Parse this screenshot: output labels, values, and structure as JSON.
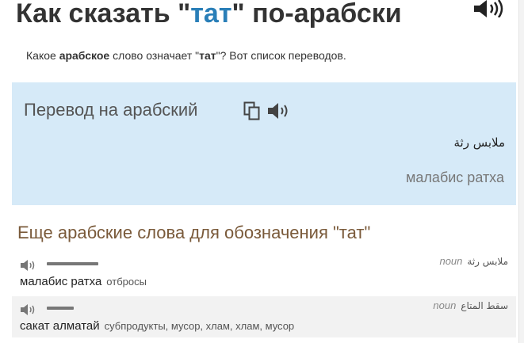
{
  "header": {
    "title_prefix": "Как сказать ",
    "quote_open": "\"",
    "word": "тат",
    "quote_close": "\"",
    "title_suffix": " по-арабски",
    "speaker_icon": "speaker-icon"
  },
  "subtitle": {
    "part1": "Какое ",
    "bold1": "арабское",
    "part2": " слово означает \"",
    "bold2": "тат",
    "part3": "\"? Вот список переводов."
  },
  "translation": {
    "heading": "Перевод на арабский",
    "copy_icon": "copy-icon",
    "speaker_icon": "speaker-icon",
    "arabic": "ملابس رثة",
    "transliteration": "малабис ратха",
    "background_color": "#d6eaf8"
  },
  "more": {
    "heading": "Еще арабские слова для обозначения \"тат\"",
    "rows": [
      {
        "pos": "noun",
        "arabic": "ملابس رثة",
        "transliteration": "малабис ратха",
        "meaning": "отбросы",
        "frequency": 0.85
      },
      {
        "pos": "noun",
        "arabic": "سقط المتاع",
        "transliteration": "сакат алматай",
        "meaning": "субпродукты, мусор, хлам, хлам, мусор",
        "frequency": 0.45
      }
    ]
  },
  "colors": {
    "title_word": "#2a7fb8",
    "heading_brown": "#7a5a3a",
    "alt_row": "#f2f2f2"
  }
}
